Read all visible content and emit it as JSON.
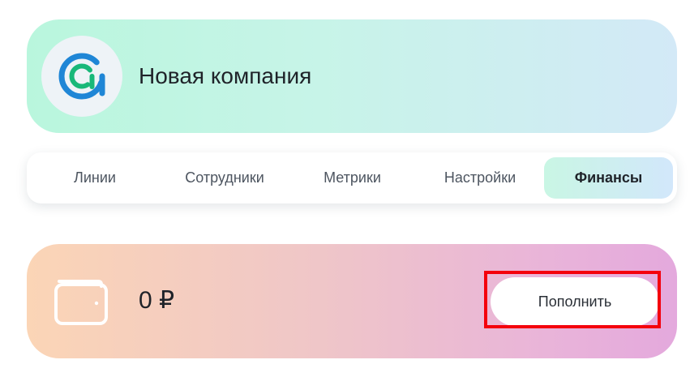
{
  "company": {
    "name": "Новая компания",
    "logo_icon": "company-logo-icon",
    "logo_colors": {
      "blue": "#1f86d6",
      "green": "#18b879",
      "ring_bg": "#ffffff"
    }
  },
  "tabs": [
    {
      "label": "Линии",
      "active": false
    },
    {
      "label": "Сотрудники",
      "active": false
    },
    {
      "label": "Метрики",
      "active": false
    },
    {
      "label": "Настройки",
      "active": false
    },
    {
      "label": "Финансы",
      "active": true
    }
  ],
  "balance": {
    "icon": "wallet-icon",
    "amount": "0 ₽",
    "topup_label": "Пополнить"
  },
  "highlight": {
    "color": "#f4000c",
    "target": "topup-button"
  }
}
